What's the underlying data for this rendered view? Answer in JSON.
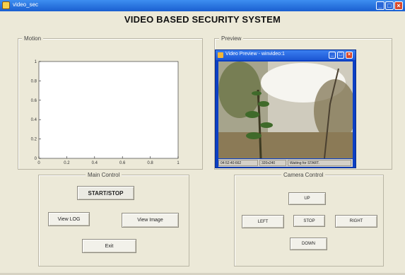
{
  "window": {
    "title": "video_sec",
    "icon": "matlab-figure-icon",
    "buttons": [
      "minimize",
      "maximize",
      "close"
    ]
  },
  "main_title": "VIDEO BASED SECURITY SYSTEM",
  "motion_panel": {
    "label": "Motion",
    "plot": {
      "xlim": [
        0,
        1
      ],
      "ylim": [
        0,
        1
      ],
      "xticks": [
        "0",
        "0.2",
        "0.4",
        "0.6",
        "0.8",
        "1"
      ],
      "yticks": [
        "0",
        "0.2",
        "0.4",
        "0.6",
        "0.8",
        "1"
      ],
      "background": "#ffffff"
    }
  },
  "preview_panel": {
    "label": "Preview",
    "video_window": {
      "title": "Video Preview - winvideo:1",
      "status": [
        "04:52:40:662",
        "320x240",
        "Waiting for START."
      ]
    }
  },
  "main_control": {
    "label": "Main Control",
    "start_stop": "START/STOP",
    "view_log": "View LOG",
    "view_image": "View Image",
    "exit": "Exit"
  },
  "camera_control": {
    "label": "Camera Control",
    "up": "UP",
    "left": "LEFT",
    "stop": "STOP",
    "right": "RIGHT",
    "down": "DOWN"
  },
  "colors": {
    "window_bg": "#ece9d8",
    "titlebar": "#1a5fd0",
    "close_button": "#d8492c"
  }
}
